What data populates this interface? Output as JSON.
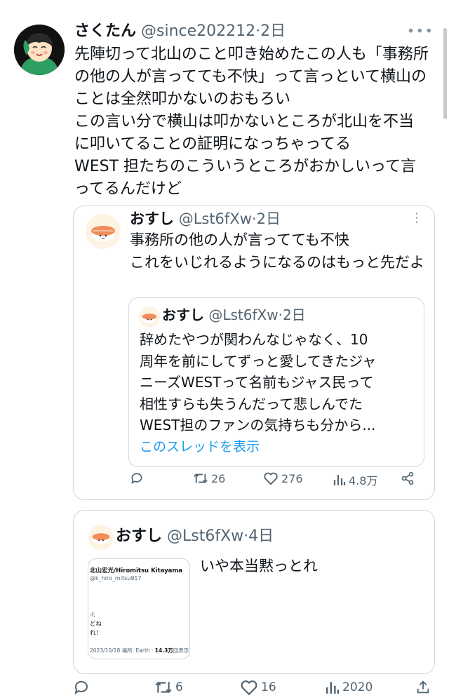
{
  "tweet": {
    "name": "さくたん",
    "handle": "@since202212",
    "sep": "·",
    "time": "2日",
    "text": "先陣切って北山のこと叩き始めたこの人も「事務所の他の人が言ってても不快」って言っといて横山のことは全然叩かないのおもろい\nこの言い分で横山は叩かないところが北山を不当に叩いてることの証明になっちゃってる\nWEST 担たちのこういうところがおかしいって言ってるんだけど",
    "more_icon": "more-dots-icon"
  },
  "quote1": {
    "name": "おすし",
    "handle": "@Lst6fXw",
    "sep": "·",
    "time": "2日",
    "text": "事務所の他の人が言ってても不快\nこれをいじれるようになるのはもっと先だよ",
    "nested": {
      "name": "おすし",
      "handle": "@Lst6fXw",
      "sep": "·",
      "time": "2日",
      "text": "辞めたやつが関わんなじゃなく、10\n周年を前にしてずっと愛してきたジャ\nニーズWESTって名前もジャス民って\n相性すらも失うんだって悲しんでた\nWEST担のファンの気持ちも分から...",
      "show_thread": "このスレッドを表示"
    },
    "actions": {
      "retweets": "26",
      "likes": "276",
      "views": "4.8万"
    }
  },
  "quote3": {
    "name": "おすし",
    "handle": "@Lst6fXw",
    "sep": "·",
    "time": "4日",
    "text": "いや本当黙っとれ",
    "image": {
      "name": "北山宏光/Hiromitsu Kitayama",
      "handle": "@k_hiro_mitsu917",
      "lines": "-l.\nどね\nれ！",
      "footer_date": "2023/10/18 場所: Earth · ",
      "footer_views": "14.3万",
      "footer_suffix": "回表示"
    }
  },
  "bottom_actions": {
    "retweets": "6",
    "likes": "16",
    "views": "2020"
  },
  "colors": {
    "link": "#1d9bf0",
    "muted": "#536471",
    "border": "#cfd9de"
  }
}
